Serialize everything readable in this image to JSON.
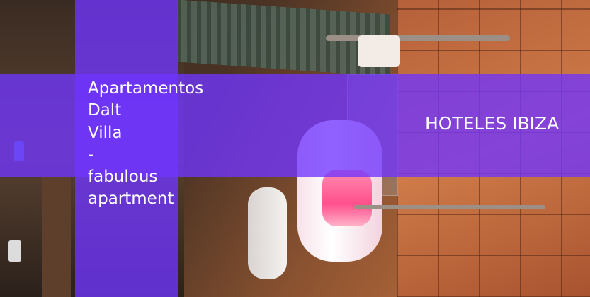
{
  "title_lines": [
    "Apartamentos",
    "Dalt",
    "Villa",
    "-",
    "fabulous",
    "apartment"
  ],
  "brand": "HOTELES IBIZA",
  "colors": {
    "overlay": "#7034ff",
    "text": "#ffffff"
  }
}
